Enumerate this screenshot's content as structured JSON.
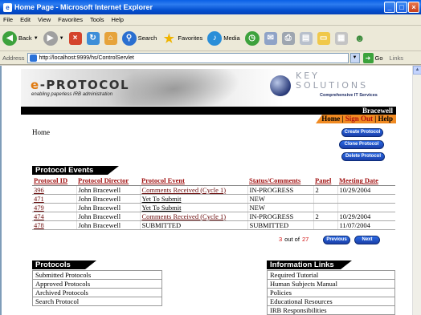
{
  "window": {
    "title": "Home Page - Microsoft Internet Explorer",
    "menu": [
      "File",
      "Edit",
      "View",
      "Favorites",
      "Tools",
      "Help"
    ],
    "toolbar": {
      "back": "Back",
      "search": "Search",
      "favorites": "Favorites",
      "media": "Media"
    },
    "address": {
      "label": "Address",
      "url": "http://localhost:9999/hs/ControlServlet",
      "go": "Go",
      "links": "Links"
    }
  },
  "banner": {
    "logo_prefix": "e",
    "logo_rest": "-PROTOCOL",
    "tagline": "enabling paperless IRB administration",
    "ks_line1": "KEY",
    "ks_line2": "SOLUTIONS",
    "ks_tagline": "Comprehensive IT Services"
  },
  "user": {
    "name": "Bracewell"
  },
  "nav": {
    "home": "Home",
    "sep1": " | ",
    "signout": "Sign Out",
    "sep2": " | ",
    "help": "Help"
  },
  "page": {
    "title": "Home"
  },
  "actions": {
    "create": "Create Protocol",
    "clone": "Clone Protocol",
    "delete": "Delete Protocol"
  },
  "events": {
    "header": "Protocol Events",
    "columns": [
      "Protocol ID",
      "Protocol Director",
      "Protocol Event",
      "Status/Comments",
      "Panel",
      "Meeting Date"
    ],
    "rows": [
      {
        "id": "396",
        "director": "John Bracewell",
        "event": "Comments Received (Cycle 1)",
        "status": "IN-PROGRESS",
        "panel": "2",
        "date": "10/29/2004"
      },
      {
        "id": "471",
        "director": "John Bracewell",
        "event": "Yet To Submit",
        "status": "NEW",
        "panel": "",
        "date": ""
      },
      {
        "id": "479",
        "director": "John Bracewell",
        "event": "Yet To Submit",
        "status": "NEW",
        "panel": "",
        "date": ""
      },
      {
        "id": "474",
        "director": "John Bracewell",
        "event": "Comments Received (Cycle 1)",
        "status": "IN-PROGRESS",
        "panel": "2",
        "date": "10/29/2004"
      },
      {
        "id": "478",
        "director": "John Bracewell",
        "event": "SUBMITTED",
        "status": "SUBMITTED",
        "panel": "",
        "date": "11/07/2004"
      }
    ],
    "pager": {
      "current": "3",
      "of": "out of",
      "total": "27",
      "previous": "Previous",
      "next": "Next"
    }
  },
  "protocols": {
    "header": "Protocols",
    "items": [
      "Submitted Protocols",
      "Approved Protocols",
      "Archived Protocols",
      "Search Protocol"
    ]
  },
  "info": {
    "header": "Information Links",
    "items": [
      "Required Tutorial",
      "Human Subjects Manual",
      "Policies",
      "Educational Resources",
      "IRB Responsibilities"
    ]
  }
}
